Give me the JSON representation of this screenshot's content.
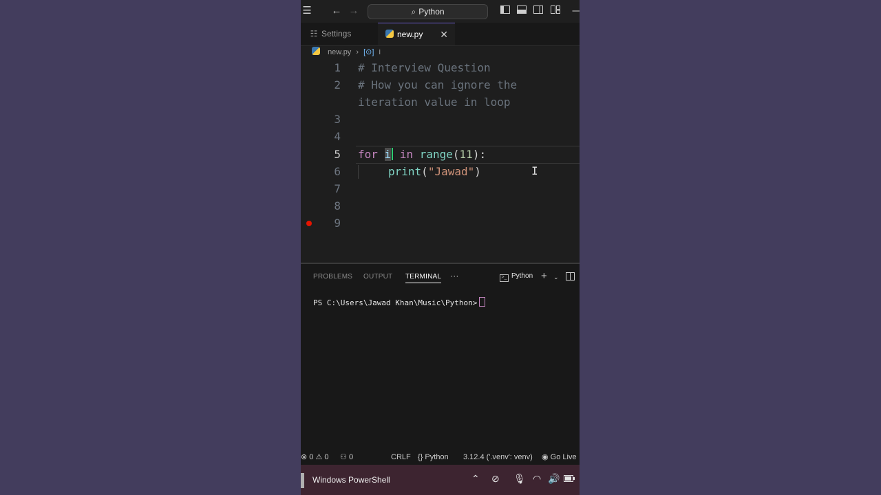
{
  "titlebar": {
    "search_label": "Python",
    "icons": [
      "menu-icon",
      "back-arrow-icon",
      "forward-arrow-icon",
      "search-icon",
      "layout-sidebar-icon",
      "layout-panel-icon",
      "layout-split-icon",
      "customize-layout-icon",
      "minimize-icon"
    ]
  },
  "tabs": {
    "settings_label": "Settings",
    "active_label": "new.py",
    "close_glyph": "✕"
  },
  "breadcrumb": {
    "file": "new.py",
    "symbol": "i"
  },
  "editor": {
    "line_numbers": [
      "1",
      "2",
      "",
      "3",
      "4",
      "5",
      "6",
      "7",
      "8",
      "9"
    ],
    "line1": "# Interview Question",
    "line2": "# How you can ignore the",
    "line2b": "iteration value in loop",
    "line5": {
      "kw_for": "for",
      "var_i": "i",
      "kw_in": "in",
      "fn_range": "range",
      "open": "(",
      "num": "11",
      "close": "):"
    },
    "line6": {
      "fn_print": "print",
      "open": "(",
      "str": "\"Jawad\"",
      "close": ")"
    }
  },
  "panel": {
    "tabs": [
      "PROBLEMS",
      "OUTPUT",
      "TERMINAL"
    ],
    "active_tab": "TERMINAL",
    "more": "···",
    "terminal_name": "Python",
    "prompt": "PS C:\\Users\\Jawad Khan\\Music\\Python>"
  },
  "statusbar": {
    "errors": "0",
    "warnings": "0",
    "ports": "0",
    "eol": "CRLF",
    "language": "Python",
    "interpreter": "3.12.4 ('.venv': venv)",
    "live": "Go Live"
  },
  "taskbar": {
    "app_label": "Windows PowerShell"
  },
  "colors": {
    "background": "#433d5d",
    "editor_bg": "#1e1e1e",
    "keyword": "#c586c0",
    "function": "#7fd3c3",
    "string": "#ce9178",
    "comment": "#6a737d",
    "breakpoint": "#e51400",
    "taskbar": "#3d2430"
  }
}
